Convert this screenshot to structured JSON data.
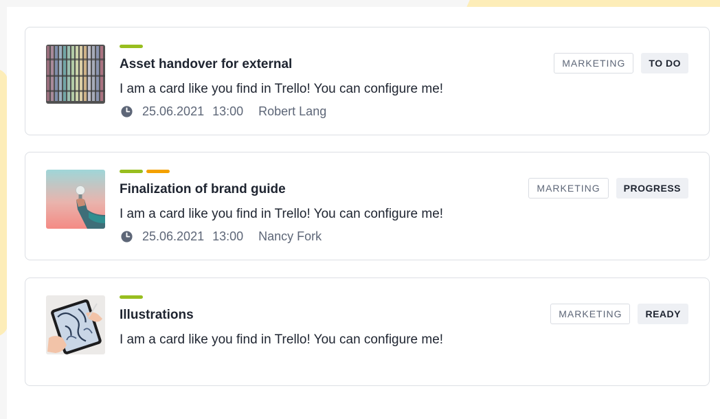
{
  "colors": {
    "label_green": "#98be1f",
    "label_orange": "#f4a100",
    "accent_yellow": "#fdedb8"
  },
  "cards": [
    {
      "title": "Asset handover for external",
      "description": "I am a card like you find in Trello! You can configure me!",
      "date": "25.06.2021",
      "time": "13:00",
      "assignee": "Robert Lang",
      "category": "MARKETING",
      "status": "TO DO",
      "labels": [
        "green"
      ],
      "image": "paint-swatches-image"
    },
    {
      "title": "Finalization of brand guide",
      "description": "I am a card like you find in Trello! You can configure me!",
      "date": "25.06.2021",
      "time": "13:00",
      "assignee": "Nancy Fork",
      "category": "MARKETING",
      "status": "PROGRESS",
      "labels": [
        "green",
        "orange"
      ],
      "image": "lightbulb-hand-image"
    },
    {
      "title": "Illustrations",
      "description": "I am a card like you find in Trello! You can configure me!",
      "category": "MARKETING",
      "status": "READY",
      "labels": [
        "green"
      ],
      "image": "tablet-drawing-image"
    }
  ]
}
